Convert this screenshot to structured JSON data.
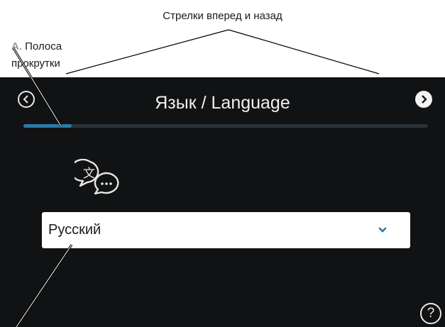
{
  "annotations": {
    "arrows_caption": "Стрелки вперед и назад",
    "scrollbar_letter": "A.",
    "scrollbar_word1": "Полоса",
    "scrollbar_word2": "прокрутки"
  },
  "screen": {
    "title": "Язык / Language",
    "back_icon": "chevron-left-circle-icon",
    "forward_icon": "chevron-right-circle-icon",
    "scroll_progress": 0.12,
    "language_icon": "translate-speech-icon",
    "language_select": {
      "value": "Русский",
      "icon": "chevron-down-icon"
    },
    "help_label": "?",
    "colors": {
      "background": "#111213",
      "accent": "#2a7ba6",
      "track": "#2a3238"
    }
  }
}
